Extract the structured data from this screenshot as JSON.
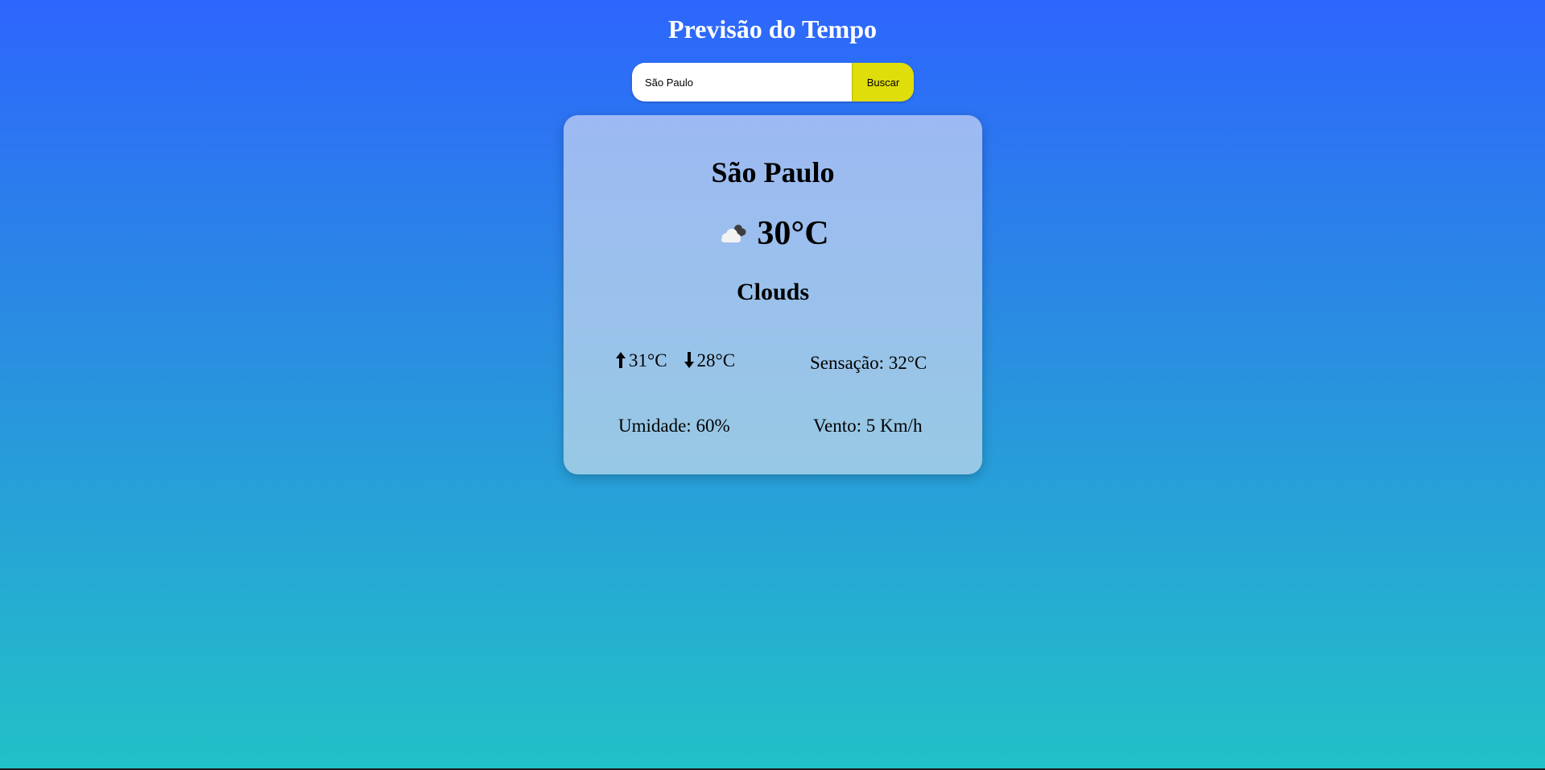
{
  "header": {
    "title": "Previsão do Tempo"
  },
  "search": {
    "value": "São Paulo",
    "button_label": "Buscar"
  },
  "weather": {
    "city": "São Paulo",
    "temperature": "30°C",
    "condition": "Clouds",
    "condition_icon": "cloud-icon",
    "max_temp": "31°C",
    "min_temp": "28°C",
    "feels_like": "Sensação: 32°C",
    "humidity": "Umidade: 60%",
    "wind": "Vento: 5 Km/h"
  },
  "colors": {
    "background_top": "#2d66fd",
    "background_bottom": "#22c1c7",
    "button": "#dfdd0a",
    "card": "#9bc0ec"
  }
}
